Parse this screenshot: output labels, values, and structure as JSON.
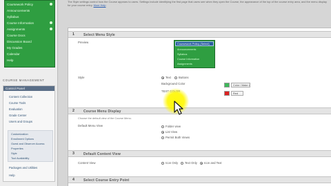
{
  "sidebar": {
    "course_menu_items": [
      {
        "label": "Coursework Policy"
      },
      {
        "label": "Announcements"
      },
      {
        "label": "Syllabus"
      },
      {
        "label": "Course Information"
      },
      {
        "label": "Assignments"
      },
      {
        "label": "Course Docs"
      },
      {
        "label": "Discussion Board"
      },
      {
        "label": "My Grades"
      },
      {
        "label": "Calendar"
      },
      {
        "label": "Help"
      }
    ],
    "management_heading": "COURSE MANAGEMENT",
    "panel_title": "Control Panel",
    "panel_links": [
      {
        "label": "Content Collection"
      },
      {
        "label": "Course Tools"
      },
      {
        "label": "Evaluation"
      },
      {
        "label": "Grade Center"
      },
      {
        "label": "Users and Groups"
      }
    ],
    "customization_links": [
      {
        "label": "Customization"
      },
      {
        "label": "Enrollment Options"
      },
      {
        "label": "Guest and Observer Access"
      },
      {
        "label": "Properties"
      },
      {
        "label": "Style"
      },
      {
        "label": "Tool Availability"
      }
    ],
    "bottom_links": [
      {
        "label": "Packages and Utilities"
      },
      {
        "label": "Help"
      }
    ]
  },
  "intro": {
    "text": "The Style settings control how the Course appears to users. Settings include identifying the first page that users see when they open the Course, the appearance of the top of the course entry area, and the menu display for your course entry. ",
    "help_link": "More Help"
  },
  "steps": [
    {
      "number": "1",
      "title": "Select Menu Style"
    },
    {
      "number": "2",
      "title": "Course Menu Display"
    },
    {
      "number": "3",
      "title": "Default Content View"
    },
    {
      "number": "4",
      "title": "Select Course Entry Point"
    }
  ],
  "menu_style": {
    "preview_label": "Preview",
    "preview_selected": "Coursework Policy (Select)",
    "preview_items": [
      "Announcements",
      "Syllabus",
      "Course Information",
      "Assignments"
    ],
    "style_label": "Style",
    "style_options": [
      {
        "label": "Text",
        "selected": true
      },
      {
        "label": "Buttons",
        "selected": false
      }
    ],
    "background_label": "Background Color",
    "background_color": "#3eb85a",
    "background_button": "Color / Make Link",
    "text_color_label": "TEXT COLOR",
    "text_color": "#dd2222",
    "text_button": "Red"
  },
  "menu_display": {
    "description": "Choose the default view of the Course Menu.",
    "default_view_label": "Default Menu View",
    "options": [
      {
        "label": "Folder view",
        "selected": false
      },
      {
        "label": "List View",
        "selected": true
      },
      {
        "label": "Permit Both Views",
        "selected": false
      }
    ]
  },
  "content_view": {
    "label": "Content View",
    "options": [
      {
        "label": "Icon Only",
        "selected": false
      },
      {
        "label": "Text Only",
        "selected": false
      },
      {
        "label": "Icon and Text",
        "selected": true
      }
    ]
  },
  "colors": {
    "menu_green": "#2f9e41",
    "cursor_highlight": "#fff700",
    "panel_header": "#5a6e87"
  }
}
